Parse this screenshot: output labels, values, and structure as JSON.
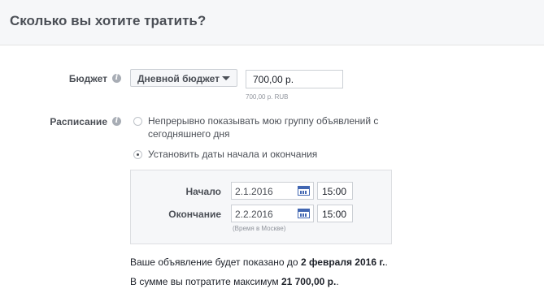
{
  "header": {
    "title": "Сколько вы хотите тратить?"
  },
  "budget": {
    "label": "Бюджет",
    "type_label": "Дневной бюджет",
    "amount": "700,00 р.",
    "hint": "700,00 р. RUB"
  },
  "schedule": {
    "label": "Расписание",
    "option_continuous": "Непрерывно показывать мою группу объявлений с",
    "option_continuous_line2": "сегодняшнего дня",
    "option_dates": "Установить даты начала и окончания",
    "start_label": "Начало",
    "start_date": "2.1.2016",
    "start_time": "15:00",
    "end_label": "Окончание",
    "end_date": "2.2.2016",
    "end_time": "15:00",
    "timezone_note": "(Время в Москве)"
  },
  "summary": {
    "line1_prefix": "Ваше объявление будет показано до ",
    "line1_bold": "2 февраля 2016 г.",
    "line1_suffix": ".",
    "line2_prefix": "В сумме вы потратите максимум ",
    "line2_bold": "21 700,00 р.",
    "line2_suffix": "."
  },
  "icons": {
    "info": "info-icon",
    "calendar": "calendar-icon"
  }
}
